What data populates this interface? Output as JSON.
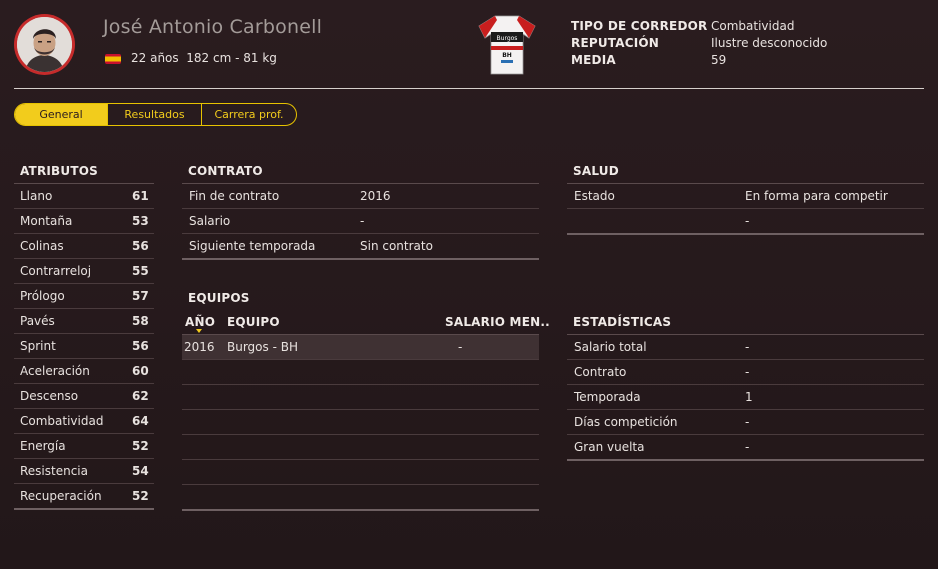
{
  "player": {
    "name": "José Antonio Carbonell",
    "info": "22 años  182 cm - 81 kg"
  },
  "header_stats": [
    {
      "label": "TIPO DE CORREDOR",
      "value": "Combatividad"
    },
    {
      "label": "REPUTACIÓN",
      "value": "Ilustre desconocido"
    },
    {
      "label": "MEDIA",
      "value": "59"
    }
  ],
  "tabs": [
    "General",
    "Resultados",
    "Carrera prof."
  ],
  "attributes": {
    "title": "ATRIBUTOS",
    "items": [
      {
        "label": "Llano",
        "value": "61"
      },
      {
        "label": "Montaña",
        "value": "53"
      },
      {
        "label": "Colinas",
        "value": "56"
      },
      {
        "label": "Contrarreloj",
        "value": "55"
      },
      {
        "label": "Prólogo",
        "value": "57"
      },
      {
        "label": "Pavés",
        "value": "58"
      },
      {
        "label": "Sprint",
        "value": "56"
      },
      {
        "label": "Aceleración",
        "value": "60"
      },
      {
        "label": "Descenso",
        "value": "62"
      },
      {
        "label": "Combatividad",
        "value": "64"
      },
      {
        "label": "Energía",
        "value": "52"
      },
      {
        "label": "Resistencia",
        "value": "54"
      },
      {
        "label": "Recuperación",
        "value": "52"
      }
    ]
  },
  "contract": {
    "title": "CONTRATO",
    "items": [
      {
        "label": "Fin de contrato",
        "value": "2016"
      },
      {
        "label": "Salario",
        "value": "-"
      },
      {
        "label": "Siguiente temporada",
        "value": "Sin contrato"
      }
    ]
  },
  "teams": {
    "title": "EQUIPOS",
    "columns": [
      "AÑO",
      "EQUIPO",
      "SALARIO MEN.."
    ],
    "rows": [
      {
        "year": "2016",
        "team": "Burgos - BH",
        "salary": "-"
      }
    ]
  },
  "health": {
    "title": "SALUD",
    "items": [
      {
        "label": "Estado",
        "value": "En forma para competir"
      },
      {
        "label": "",
        "value": "-"
      }
    ]
  },
  "stats": {
    "title": "ESTADÍSTICAS",
    "items": [
      {
        "label": "Salario total",
        "value": "-"
      },
      {
        "label": "Contrato",
        "value": "-"
      },
      {
        "label": "Temporada",
        "value": "1"
      },
      {
        "label": "Días competición",
        "value": "-"
      },
      {
        "label": "Gran vuelta",
        "value": "-"
      }
    ]
  },
  "colors": {
    "background": "#261a1c",
    "accent": "#f2cc1c",
    "avatar_ring": "#c62b2b"
  },
  "icons": {
    "flag": "spain-flag-icon",
    "jersey": "team-jersey-icon",
    "sort": "sort-caret-icon"
  }
}
